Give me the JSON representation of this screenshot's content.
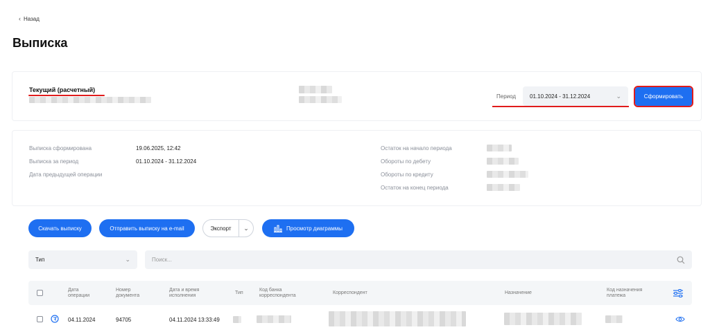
{
  "nav": {
    "back_label": "Назад"
  },
  "page": {
    "title": "Выписка"
  },
  "account": {
    "name": "Текущий (расчетный)"
  },
  "period": {
    "label": "Период",
    "value": "01.10.2024 - 31.12.2024",
    "submit_label": "Сформировать"
  },
  "info": {
    "left": [
      {
        "label": "Выписка сформирована",
        "value": "19.06.2025, 12:42"
      },
      {
        "label": "Выписка за период",
        "value": "01.10.2024 - 31.12.2024"
      },
      {
        "label": "Дата предыдущей операции",
        "value": ""
      }
    ],
    "right": [
      {
        "label": "Остаток на начало периода"
      },
      {
        "label": "Обороты по дебету"
      },
      {
        "label": "Обороты по кредиту"
      },
      {
        "label": "Остаток на конец периода"
      }
    ]
  },
  "actions": {
    "download_label": "Скачать выписку",
    "email_label": "Отправить выписку на e-mail",
    "export_label": "Экспорт",
    "chart_label": "Просмотр диаграммы"
  },
  "filters": {
    "type_label": "Тип",
    "search_placeholder": "Поиск..."
  },
  "table": {
    "headers": {
      "date_op": "Дата операции",
      "doc_num": "Номер документа",
      "exec_dt": "Дата и время исполнения",
      "type": "Тип",
      "bank_code": "Код банка корреспондента",
      "correspondent": "Корреспондент",
      "purpose": "Назначение",
      "purpose_code": "Код назначения платежа"
    },
    "rows": [
      {
        "date_op": "04.11.2024",
        "doc_num": "94705",
        "exec_dt": "04.11.2024 13:33:49"
      }
    ]
  },
  "colors": {
    "accent": "#1e6ff1",
    "annotation": "#e01b1b"
  }
}
